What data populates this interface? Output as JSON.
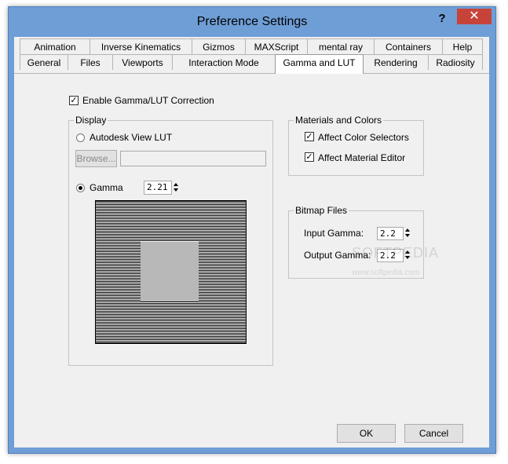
{
  "window": {
    "title": "Preference Settings",
    "help_glyph": "?",
    "close_glyph": "✕"
  },
  "tabs_row1": [
    "Animation",
    "Inverse Kinematics",
    "Gizmos",
    "MAXScript",
    "mental ray",
    "Containers",
    "Help"
  ],
  "tabs_row2": [
    "General",
    "Files",
    "Viewports",
    "Interaction Mode",
    "Gamma and LUT",
    "Rendering",
    "Radiosity"
  ],
  "active_tab": "Gamma and LUT",
  "enable_gamma": {
    "label": "Enable Gamma/LUT Correction",
    "checked": true
  },
  "display": {
    "legend": "Display",
    "autodesk_lut": {
      "label": "Autodesk View LUT",
      "selected": false
    },
    "browse_label": "Browse...",
    "lut_path": "",
    "gamma": {
      "label": "Gamma",
      "selected": true,
      "value": "2.21"
    }
  },
  "materials": {
    "legend": "Materials and Colors",
    "affect_color_selectors": {
      "label": "Affect Color Selectors",
      "checked": true
    },
    "affect_material_editor": {
      "label": "Affect Material Editor",
      "checked": true
    }
  },
  "bitmap": {
    "legend": "Bitmap Files",
    "input_gamma": {
      "label": "Input Gamma:",
      "value": "2.2"
    },
    "output_gamma": {
      "label": "Output Gamma:",
      "value": "2.2"
    }
  },
  "buttons": {
    "ok": "OK",
    "cancel": "Cancel"
  },
  "watermark": {
    "logo": "SOFTPEDIA",
    "url": "www.softpedia.com"
  },
  "colors": {
    "title_bar": "#6f9ed6",
    "close_button": "#c7433a",
    "client": "#f0f0f0"
  }
}
